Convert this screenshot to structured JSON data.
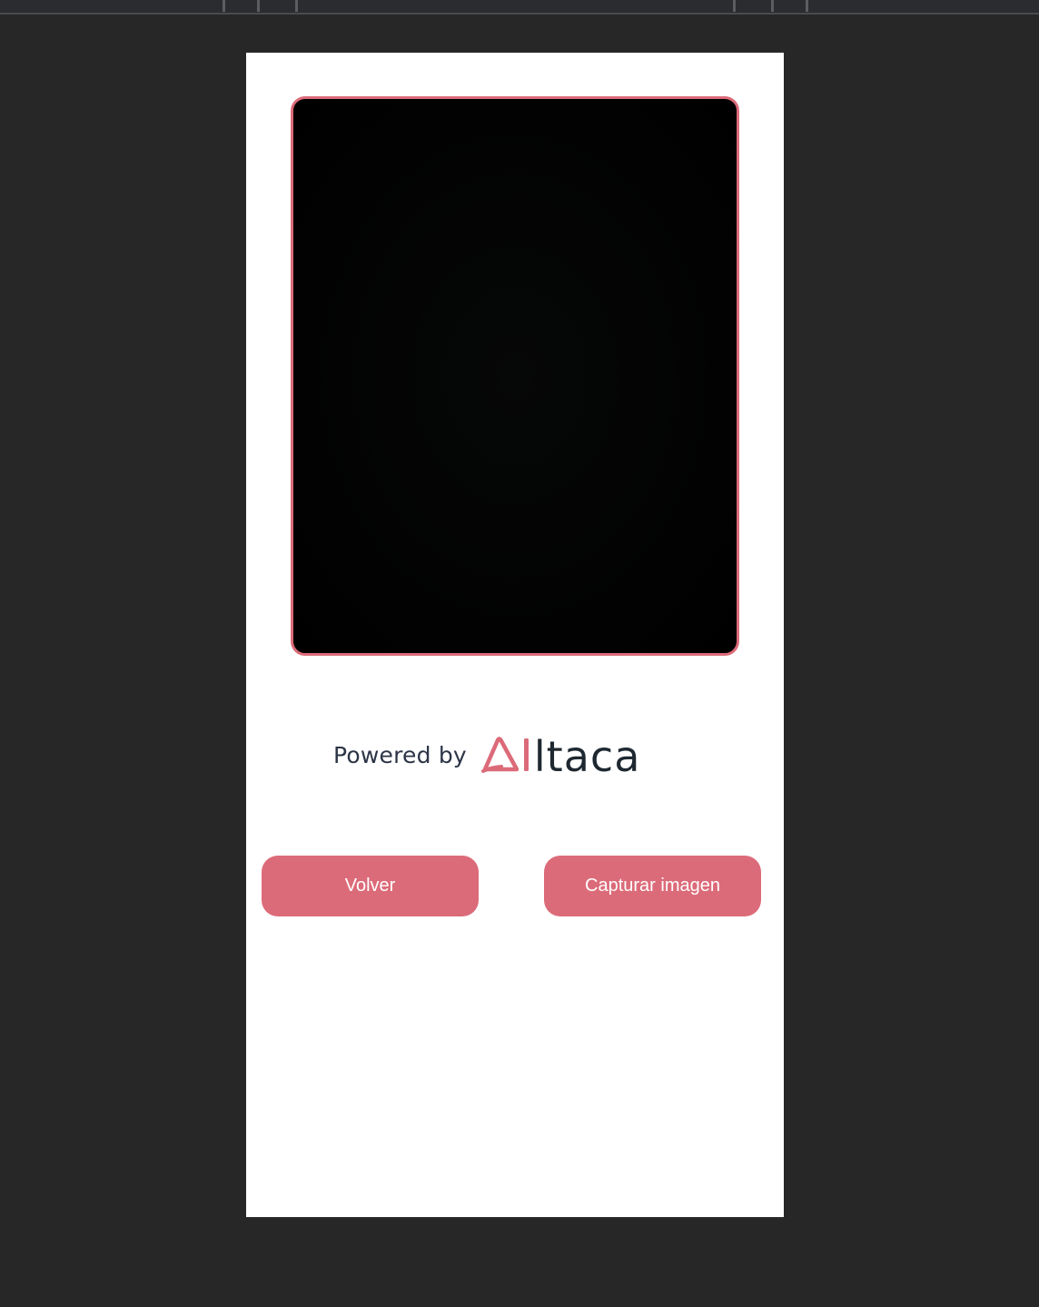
{
  "footer": {
    "powered_by": "Powered by",
    "logo_text": "ltaca"
  },
  "actions": {
    "back_label": "Volver",
    "capture_label": "Capturar imagen"
  },
  "colors": {
    "accent": "#dc6b79",
    "page_background": "#272727",
    "frame_background": "#ffffff",
    "viewport_background": "#030303"
  }
}
